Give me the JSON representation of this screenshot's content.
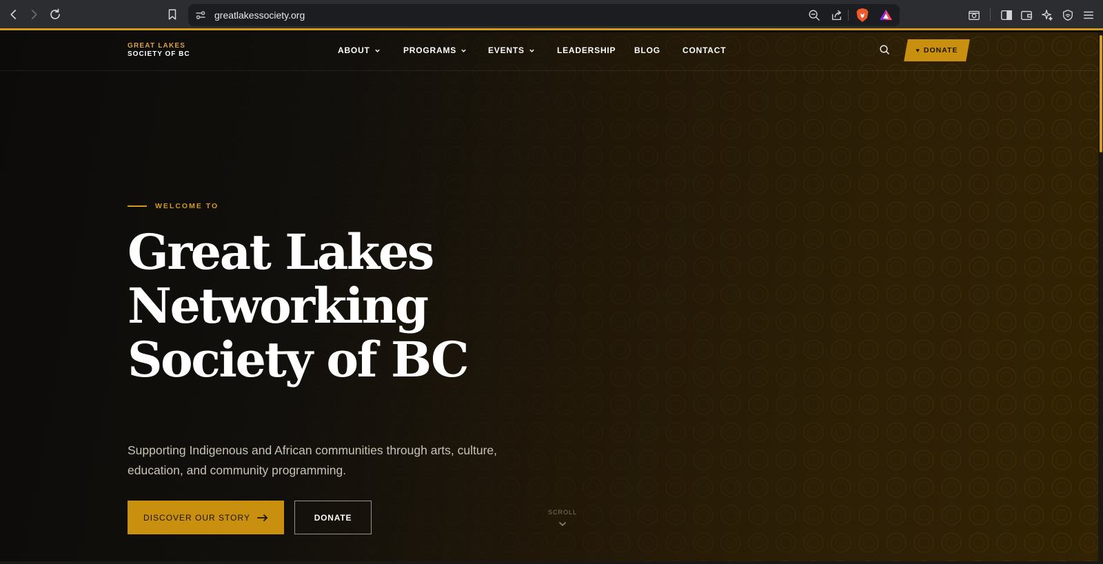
{
  "browser": {
    "url": "greatlakessociety.org",
    "icons": [
      "back-icon",
      "forward-icon",
      "reload-icon",
      "bookmark-icon",
      "site-settings-icon",
      "zoom-out-icon",
      "share-icon",
      "brave-shields-icon",
      "brave-rewards-icon",
      "screenshot-icon",
      "sidebar-icon",
      "wallet-icon",
      "leo-ai-icon",
      "vpn-icon",
      "menu-icon"
    ]
  },
  "header": {
    "logo_top": "GREAT LAKES",
    "logo_bottom": "SOCIETY OF BC",
    "menu": [
      {
        "label": "ABOUT",
        "dropdown": true
      },
      {
        "label": "PROGRAMS",
        "dropdown": true
      },
      {
        "label": "EVENTS",
        "dropdown": true
      },
      {
        "label": "LEADERSHIP",
        "dropdown": false
      },
      {
        "label": "BLOG",
        "dropdown": false
      },
      {
        "label": "CONTACT",
        "dropdown": false
      }
    ],
    "donate_label": "DONATE",
    "donate_icon": "heart-icon"
  },
  "hero": {
    "eyebrow": "WELCOME TO",
    "title_lines": [
      "Great Lakes",
      "Networking",
      "Society of BC"
    ],
    "subtitle": "Supporting Indigenous and African communities through arts, culture, education, and community programming.",
    "primary_cta": "DISCOVER OUR STORY",
    "secondary_cta": "DONATE",
    "scroll_label": "SCROLL"
  },
  "colors": {
    "accent": "#d39a1e",
    "button_gold": "#c8900e",
    "background_dark": "#0e0d0c",
    "background_warm": "#332304"
  }
}
